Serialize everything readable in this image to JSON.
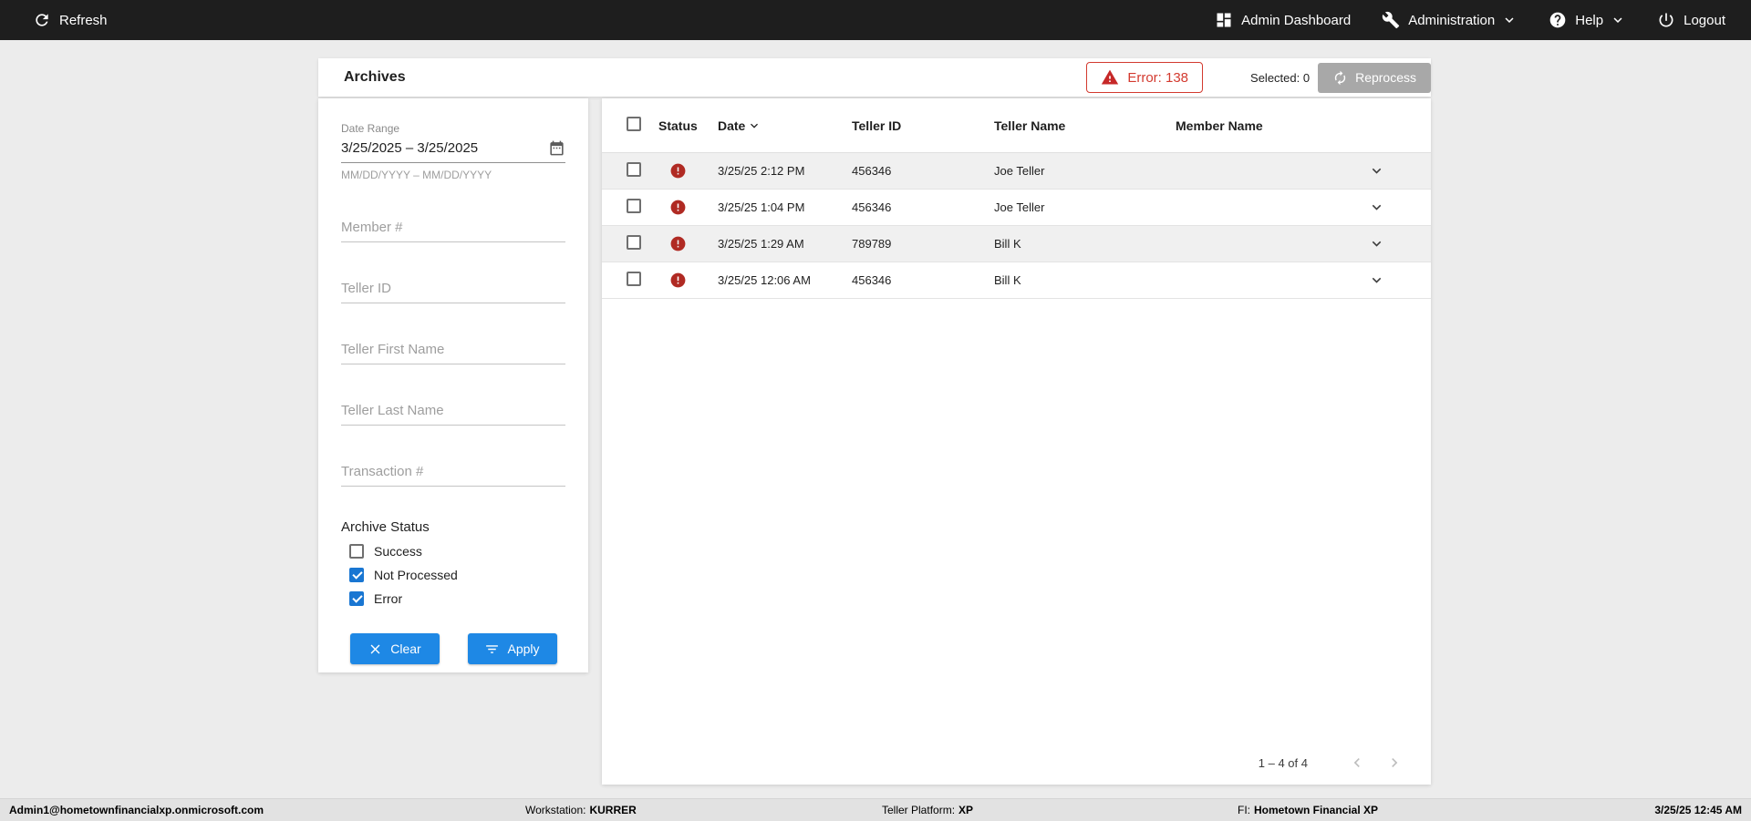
{
  "topbar": {
    "refresh_label": "Refresh",
    "admin_dashboard_label": "Admin Dashboard",
    "administration_label": "Administration",
    "help_label": "Help",
    "logout_label": "Logout"
  },
  "header": {
    "title": "Archives",
    "error_badge": "Error: 138",
    "selected_label": "Selected: 0",
    "reprocess_label": "Reprocess"
  },
  "filters": {
    "date_range_label": "Date Range",
    "date_range_value": "3/25/2025 – 3/25/2025",
    "date_range_hint": "MM/DD/YYYY – MM/DD/YYYY",
    "member_placeholder": "Member #",
    "teller_id_placeholder": "Teller ID",
    "teller_first_placeholder": "Teller First Name",
    "teller_last_placeholder": "Teller Last Name",
    "transaction_placeholder": "Transaction #",
    "archive_status_label": "Archive Status",
    "statuses": [
      {
        "label": "Success",
        "checked": false
      },
      {
        "label": "Not Processed",
        "checked": true
      },
      {
        "label": "Error",
        "checked": true
      }
    ],
    "clear_label": "Clear",
    "apply_label": "Apply"
  },
  "table": {
    "columns": [
      "Status",
      "Date",
      "Teller ID",
      "Teller Name",
      "Member Name"
    ],
    "rows": [
      {
        "status": "error",
        "date": "3/25/25 2:12 PM",
        "teller_id": "456346",
        "teller_name": "Joe Teller",
        "member_name": ""
      },
      {
        "status": "error",
        "date": "3/25/25 1:04 PM",
        "teller_id": "456346",
        "teller_name": "Joe Teller",
        "member_name": ""
      },
      {
        "status": "error",
        "date": "3/25/25 1:29 AM",
        "teller_id": "789789",
        "teller_name": "Bill K",
        "member_name": ""
      },
      {
        "status": "error",
        "date": "3/25/25 12:06 AM",
        "teller_id": "456346",
        "teller_name": "Bill K",
        "member_name": ""
      }
    ],
    "pagination": "1 – 4 of 4"
  },
  "statusbar": {
    "user": "Admin1@hometownfinancialxp.onmicrosoft.com",
    "workstation_label": "Workstation:",
    "workstation_value": "KURRER",
    "platform_label": "Teller Platform:",
    "platform_value": "XP",
    "fi_label": "FI:",
    "fi_value": "Hometown Financial XP",
    "datetime": "3/25/25 12:45 AM"
  },
  "colors": {
    "topbar_bg": "#1e1e1e",
    "accent_blue": "#1e88e5",
    "checkbox_blue": "#1976d2",
    "error_red": "#c62828",
    "badge_red": "#d33a2f",
    "reprocess_gray": "#a8a8a8",
    "row_alt_bg": "#f0f0f0"
  },
  "icons": {
    "refresh-icon": "circular-arrow",
    "dashboard-icon": "grid-squares",
    "wrench-icon": "wrench",
    "help-icon": "question-circle",
    "power-icon": "power",
    "chevron-down-icon": "chevron-down",
    "calendar-icon": "calendar",
    "warning-icon": "triangle-exclamation",
    "error-status-icon": "circle-exclamation",
    "clear-icon": "x",
    "filter-icon": "filter-lines",
    "reprocess-icon": "autorenew",
    "sort-desc-icon": "chevron-down",
    "chevron-left-icon": "chevron-left",
    "chevron-right-icon": "chevron-right",
    "expand-row-icon": "chevron-down"
  }
}
